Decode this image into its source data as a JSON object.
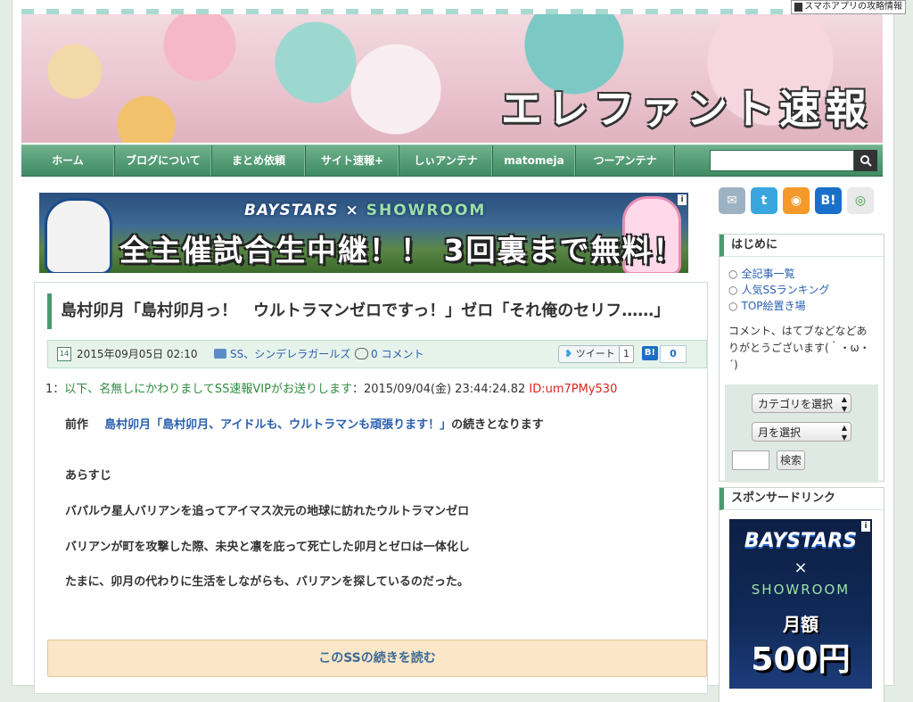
{
  "top_tag": "スマホアプリの攻略情報",
  "site": {
    "title": "エレファント速報"
  },
  "nav": {
    "items": [
      "ホーム",
      "ブログについて",
      "まとめ依頼",
      "サイト速報+",
      "しぃアンテナ",
      "matomeja",
      "つーアンテナ"
    ],
    "search_placeholder": ""
  },
  "top_ad": {
    "brand_left": "BAYSTARS",
    "brand_x": "×",
    "brand_right": "SHOWROOM",
    "headline": "全主催試合生中継！！ 3回裏まで無料！",
    "info": "i"
  },
  "post": {
    "title": "島村卯月「島村卯月っ！　ウルトラマンゼロですっ！」ゼロ「それ俺のセリフ……」",
    "date_icon": "14",
    "date": "2015年09月05日 02:10",
    "categories": "SS、シンデレラガールズ",
    "comments": "0 コメント",
    "tweet_label": "ツイート",
    "tweet_count": "1",
    "hatena_label": "B!",
    "hatena_count": "0",
    "res_num": "1：",
    "res_name": "以下、名無しにかわりましてSS速報VIPがお送りします",
    "res_date": "：2015/09/04(金) 23:44:24.82",
    "res_id": "ID:um7PMy530",
    "prev_label": "前作",
    "prev_link": "島村卯月「島村卯月、アイドルも、ウルトラマンも頑張ります！」",
    "prev_suffix": "の続きとなります",
    "synopsis_label": "あらすじ",
    "lines": [
      "バパルウ星人バリアンを追ってアイマス次元の地球に訪れたウルトラマンゼロ",
      "バリアンが町を攻撃した際、未央と凛を庇って死亡した卯月とゼロは一体化し",
      "たまに、卯月の代わりに生活をしながらも、バリアンを探しているのだった。"
    ],
    "continue_label": "このSSの続きを読む"
  },
  "sidebar": {
    "social": [
      {
        "name": "mail-icon",
        "glyph": "✉",
        "color": "#9db3c4"
      },
      {
        "name": "twitter-icon",
        "glyph": "t",
        "color": "#3aa6dd"
      },
      {
        "name": "rss-icon",
        "glyph": "◉",
        "color": "#f39a2a"
      },
      {
        "name": "hatena-bookmark-icon",
        "glyph": "B!",
        "color": "#1a6fc9"
      },
      {
        "name": "chrome-icon",
        "glyph": "◎",
        "color": "#e9e9e9"
      }
    ],
    "intro_title": "はじめに",
    "links": [
      "全記事一覧",
      "人気SSランキング",
      "TOP絵置き場"
    ],
    "description": "コメント、はてブなどなどありがとうございます(｀・ω・´)",
    "category_select": "カテゴリを選択",
    "month_select": "月を選択",
    "search_button": "検索",
    "sponsor_title": "スポンサードリンク",
    "side_ad": {
      "brand": "BAYSTARS",
      "x": "×",
      "showroom": "SHOWROOM",
      "monthly": "月額",
      "price": "500円"
    }
  }
}
